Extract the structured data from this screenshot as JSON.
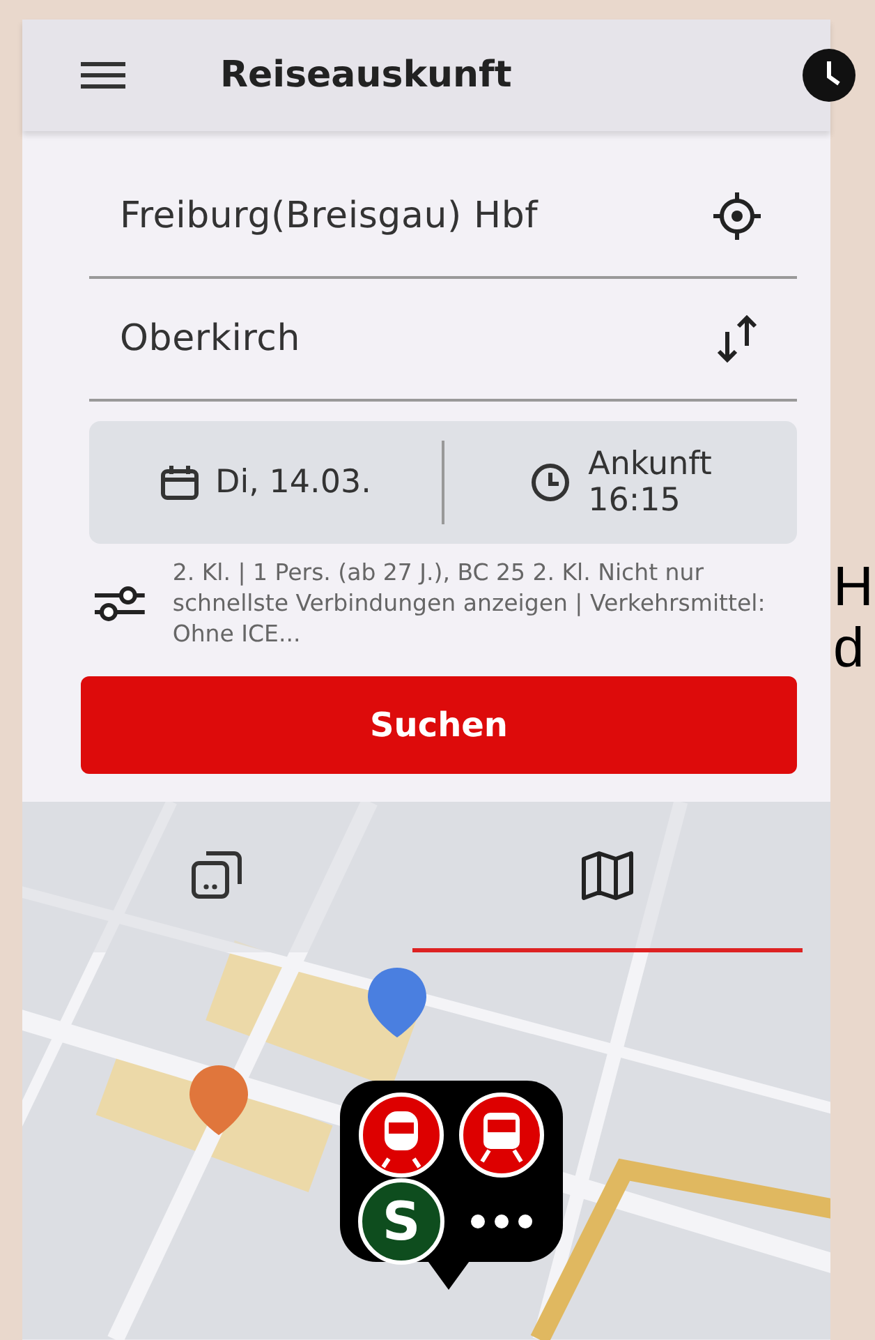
{
  "app_bar": {
    "title": "Reiseauskunft"
  },
  "from": {
    "value": "Freiburg(Breisgau) Hbf"
  },
  "to": {
    "value": "Oberkirch"
  },
  "date": {
    "value": "Di, 14.03."
  },
  "time": {
    "mode": "Ankunft",
    "value": "16:15"
  },
  "options": {
    "summary": "2. Kl. | 1 Pers. (ab 27 J.), BC 25 2. Kl. Nicht nur schnellste Verbindungen anzeigen | Verkehrsmittel: Ohne ICE..."
  },
  "search_button": {
    "label": "Suchen"
  },
  "view_tabs": [
    {
      "kind": "list",
      "selected": false
    },
    {
      "kind": "map",
      "selected": true
    }
  ],
  "map": {
    "kind": "picture",
    "marker": {
      "badge": "S"
    }
  },
  "side_text": {
    "lines": [
      "H",
      "d"
    ]
  }
}
